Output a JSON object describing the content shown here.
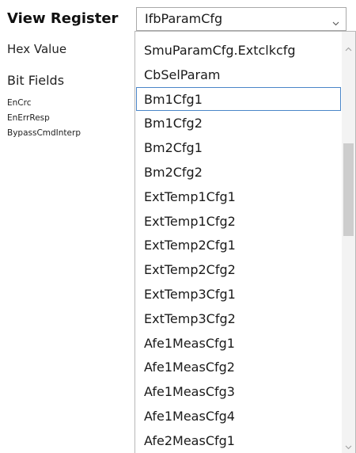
{
  "panel": {
    "title": "View Register",
    "hex_label": "Hex Value",
    "bit_fields_label": "Bit Fields",
    "bit_fields": [
      "EnCrc",
      "EnErrResp",
      "BypassCmdInterp"
    ]
  },
  "register_select": {
    "selected_value": "IfbParamCfg",
    "arrow_icon": "chevron-down-icon",
    "highlighted_option": "Bm1Cfg1",
    "options": [
      "SmuParamCfg.Extclkcfg",
      "CbSelParam",
      "Bm1Cfg1",
      "Bm1Cfg2",
      "Bm2Cfg1",
      "Bm2Cfg2",
      "ExtTemp1Cfg1",
      "ExtTemp1Cfg2",
      "ExtTemp2Cfg1",
      "ExtTemp2Cfg2",
      "ExtTemp3Cfg1",
      "ExtTemp3Cfg2",
      "Afe1MeasCfg1",
      "Afe1MeasCfg2",
      "Afe1MeasCfg3",
      "Afe1MeasCfg4",
      "Afe2MeasCfg1"
    ]
  },
  "colors": {
    "selection_border": "#4a86c8",
    "scroll_thumb": "#cdcdcd",
    "scroll_track": "#f3f3f3"
  }
}
